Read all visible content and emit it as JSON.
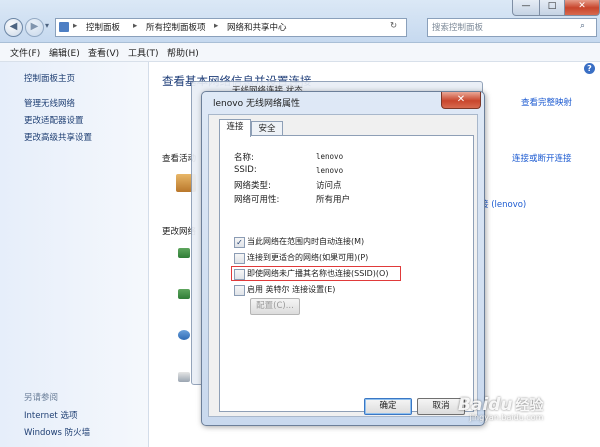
{
  "nav": {
    "back_glyph": "◀",
    "forward_glyph": "▶",
    "history_glyph": "▾",
    "address": [
      "控制面板",
      "所有控制面板项",
      "网络和共享中心"
    ],
    "separator": "▸",
    "refresh_glyph": "↻",
    "search_placeholder": "搜索控制面板",
    "minimize_glyph": "—",
    "maximize_glyph": "□",
    "close_glyph": "✕"
  },
  "menu": {
    "file": "文件(F)",
    "edit": "编辑(E)",
    "view": "查看(V)",
    "tools": "工具(T)",
    "help": "帮助(H)"
  },
  "help_glyph": "?",
  "sidebar": {
    "home": "控制面板主页",
    "manage_wireless": "管理无线网络",
    "change_adapter": "更改适配器设置",
    "change_sharing": "更改高级共享设置",
    "see_also": "另请参阅",
    "internet_options": "Internet 选项",
    "firewall": "Windows 防火墙"
  },
  "main": {
    "title": "查看基本网络信息并设置连接",
    "view_full_map": "查看完整映射",
    "active_networks": "查看活动",
    "connect_or_disconnect": "连接或断开连接",
    "network_suffix": "接 (lenovo)",
    "change_network": "更改网络"
  },
  "bg_window_title": "无线网络连接 状态",
  "dialog": {
    "title": "lenovo 无线网络属性",
    "close_glyph": "✕",
    "tabs": [
      "连接",
      "安全"
    ],
    "props": [
      {
        "label": "名称:",
        "value": "lenovo"
      },
      {
        "label": "SSID:",
        "value": "lenovo"
      },
      {
        "label": "网络类型:",
        "value": "访问点"
      },
      {
        "label": "网络可用性:",
        "value": "所有用户"
      }
    ],
    "check_glyph": "✓",
    "options": [
      {
        "label": "当此网络在范围内时自动连接(M)",
        "checked": true
      },
      {
        "label": "连接到更适合的网络(如果可用)(P)",
        "checked": false
      },
      {
        "label": "即使网络未广播其名称也连接(SSID)(O)",
        "checked": false
      },
      {
        "label": "启用 英特尔 连接设置(E)",
        "checked": false
      }
    ],
    "configure_button": "配置(C)...",
    "ok_button": "确定",
    "cancel_button": "取消"
  },
  "watermark": {
    "logo": "Bai",
    "paw": "du",
    "suffix": "经验",
    "url": "jingyan.baidu.com"
  },
  "colors": {
    "link": "#1b5ad1",
    "highlight_box": "#e03a3a",
    "close_button": "#c8452c"
  }
}
